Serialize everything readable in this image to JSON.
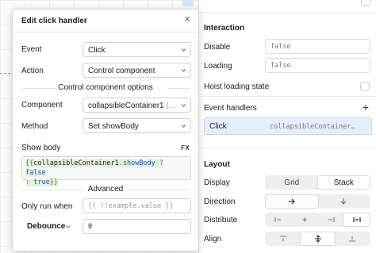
{
  "modal": {
    "title": "Edit click handler",
    "close_glyph": "×",
    "event_label": "Event",
    "event_value": "Click",
    "action_label": "Action",
    "action_value": "Control component",
    "options_heading": "Control component options",
    "component_label": "Component",
    "component_value": "collapsibleContainer1",
    "component_value_suffix": " (…",
    "method_label": "Method",
    "method_value": "Set showBody",
    "show_body_label": "Show body",
    "fx_label": "FX",
    "code_open": "{{",
    "code_ident": "collapsibleContainer1",
    "code_dot": ".",
    "code_prop": "showBody",
    "code_q": " ? ",
    "code_false": "false",
    "code_colon": ": ",
    "code_true": "true",
    "code_close": "}}",
    "advanced_heading": "Advanced",
    "only_run_label": "Only run when",
    "only_run_placeholder": "{{ !!example.value }}",
    "debounce_label": "Debounce",
    "debounce_value": "0"
  },
  "inspector": {
    "interaction_title": "Interaction",
    "disable_label": "Disable",
    "disable_value": "false",
    "loading_label": "Loading",
    "loading_value": "false",
    "hoist_label": "Hoist loading state",
    "event_handlers_title": "Event handlers",
    "add_glyph": "+",
    "handler_event": "Click",
    "handler_action": "collapsibleContainer…",
    "layout_title": "Layout",
    "display_label": "Display",
    "display_options": [
      "Grid",
      "Stack"
    ],
    "display_selected": "Stack",
    "direction_label": "Direction",
    "distribute_label": "Distribute",
    "align_label": "Align"
  },
  "colors": {
    "accent": "#2a5cc7",
    "handler_row_bg": "#e6eefb",
    "selection_dash": "#7aa3e5"
  },
  "icons": {
    "close": "close-icon",
    "chevron": "chevron-down-icon",
    "add": "plus-icon",
    "direction_right": "arrow-right-icon",
    "direction_down": "arrow-down-icon",
    "distribute_start": "distribute-start-icon",
    "distribute_center": "distribute-center-icon",
    "distribute_end": "distribute-end-icon",
    "distribute_between": "distribute-between-icon",
    "align_top": "align-top-icon",
    "align_center": "align-center-icon",
    "align_bottom": "align-bottom-icon"
  }
}
